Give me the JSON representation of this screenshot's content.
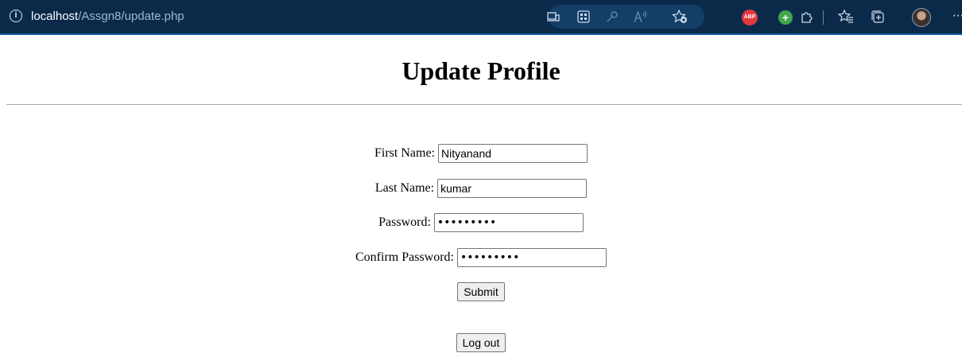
{
  "browser": {
    "url_host": "localhost",
    "url_path": "/Assgn8/update.php",
    "info_icon": "i",
    "toolbar_icons": [
      "device-icon",
      "apps-icon",
      "key-icon",
      "read-aloud-icon",
      "add-favorite-icon",
      "adblock-extension-icon",
      "plus-extension-icon",
      "extensions-icon",
      "favorites-icon",
      "collections-icon",
      "profile-avatar",
      "more-icon"
    ],
    "abp_label": "ABP",
    "plus_label": "+"
  },
  "page": {
    "title": "Update Profile"
  },
  "form": {
    "first_name_label": "First Name:",
    "first_name_value": "Nityanand",
    "last_name_label": "Last Name:",
    "last_name_value": "kumar",
    "password_label": "Password:",
    "password_value": "password1",
    "confirm_password_label": "Confirm Password:",
    "confirm_password_value": "password1",
    "submit_label": "Submit",
    "logout_label": "Log out"
  }
}
